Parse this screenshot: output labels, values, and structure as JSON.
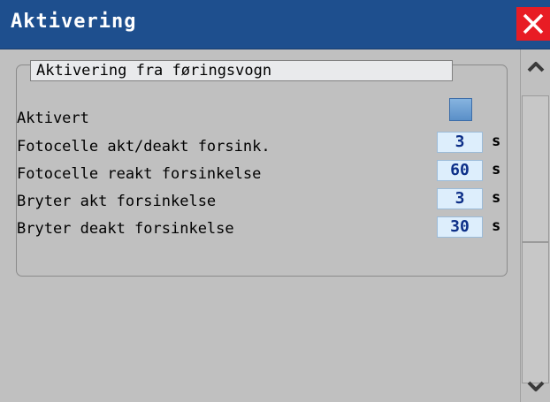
{
  "window": {
    "title": "Aktivering",
    "title_bar_color": "#1e4f8e",
    "close_color": "#e81c24"
  },
  "group": {
    "title": "Aktivering fra føringsvogn"
  },
  "settings": {
    "activated": {
      "label": "Aktivert",
      "checked": false
    },
    "photocell_act_deact": {
      "label": "Fotocelle akt/deakt forsink.",
      "value": "3",
      "unit": "s"
    },
    "photocell_react": {
      "label": "Fotocelle reakt forsinkelse",
      "value": "60",
      "unit": "s"
    },
    "switch_act": {
      "label": "Bryter akt forsinkelse",
      "value": "3",
      "unit": "s"
    },
    "switch_deact": {
      "label": "Bryter deakt forsinkelse",
      "value": "30",
      "unit": "s"
    }
  },
  "scrollbar": {
    "up_icon": "chevron-up-icon",
    "down_icon": "chevron-down-icon"
  }
}
